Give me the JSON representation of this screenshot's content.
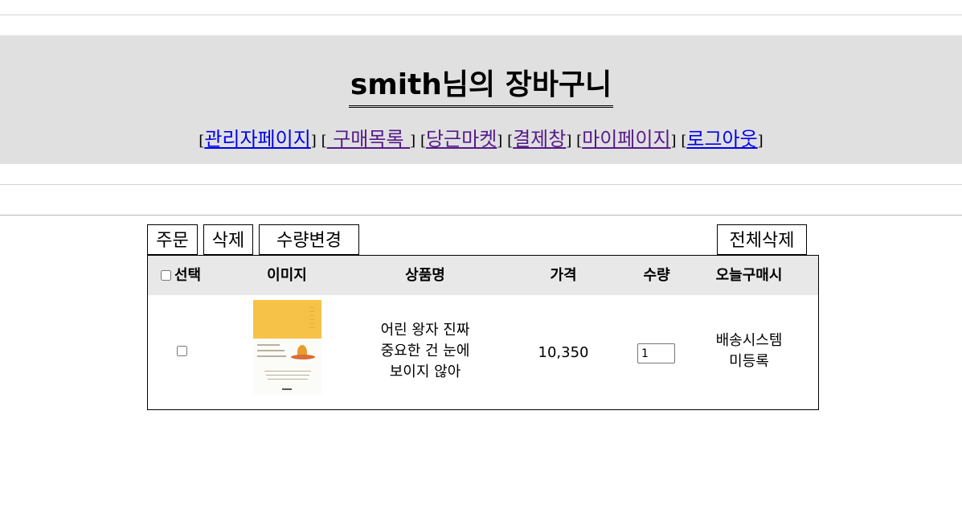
{
  "header": {
    "title": "smith님의 장바구니",
    "nav": [
      {
        "label": "관리자페이지",
        "visited": false
      },
      {
        "label": " 구매목록 ",
        "visited": true
      },
      {
        "label": "당근마켓",
        "visited": true
      },
      {
        "label": "결제창",
        "visited": true
      },
      {
        "label": "마이페이지",
        "visited": true
      },
      {
        "label": "로그아웃",
        "visited": false
      }
    ],
    "nav_bracket_open": "[",
    "nav_bracket_close": "]"
  },
  "toolbar": {
    "order_label": "주문",
    "delete_label": "삭제",
    "change_qty_label": "수량변경",
    "delete_all_label": "전체삭제"
  },
  "table": {
    "headers": {
      "select": "선택",
      "image": "이미지",
      "name": "상품명",
      "price": "가격",
      "quantity": "수량",
      "today": "오늘구매시"
    },
    "rows": [
      {
        "name_line1": "어린 왕자 진짜",
        "name_line2": "중요한 건 눈에",
        "name_line3": "보이지 않아",
        "price": "10,350",
        "quantity": "1",
        "today_line1": "배송시스템",
        "today_line2": "미등록",
        "image_icon": "book-cover-image"
      }
    ]
  },
  "colors": {
    "banner_bg": "#e0e0e0",
    "table_header_bg": "#e8e8e8",
    "link_unvisited": "#0000ee",
    "link_visited": "#551a8b",
    "book_cover_yellow": "#f6c247"
  }
}
